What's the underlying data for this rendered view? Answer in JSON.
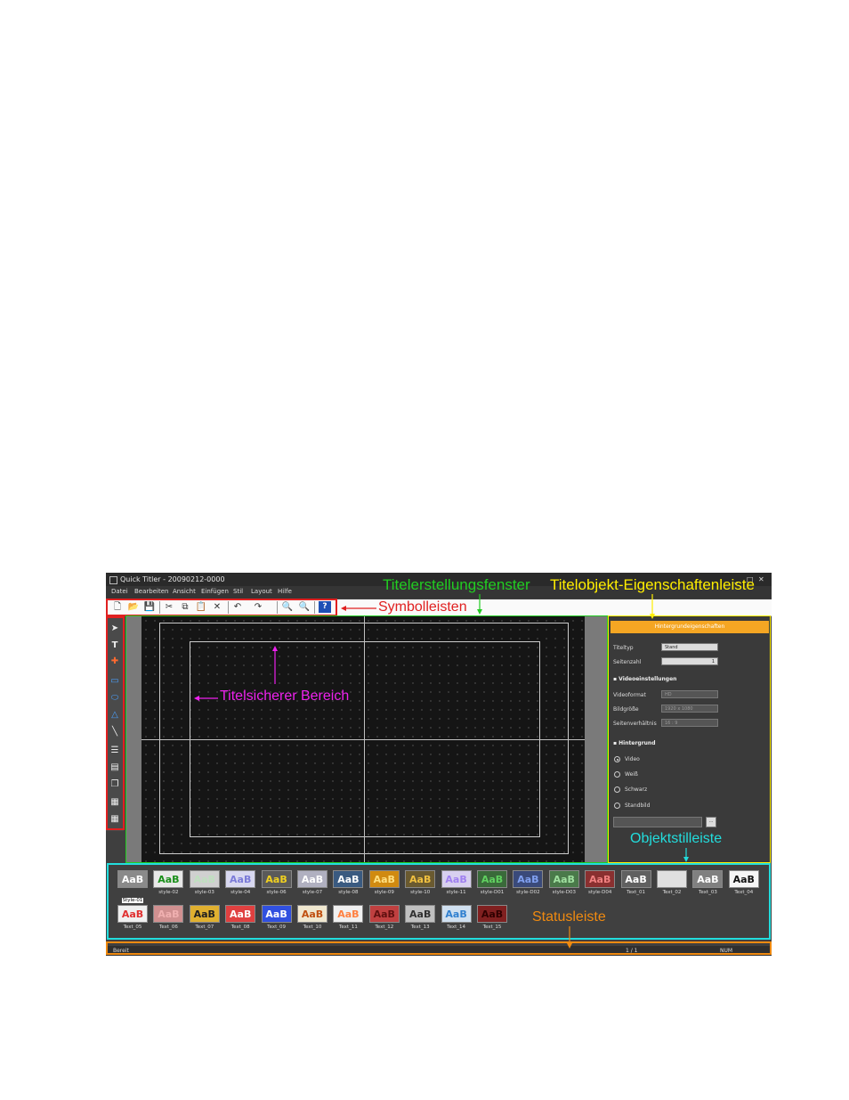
{
  "window": {
    "title": "Quick Titler - 20090212-0000",
    "controls": [
      "_",
      "□",
      "✕"
    ]
  },
  "menu": [
    "Datei",
    "Bearbeiten",
    "Ansicht",
    "Einfügen",
    "Stil",
    "Layout",
    "Hilfe"
  ],
  "toolbar": {
    "new": "🗋",
    "open": "📂",
    "save": "💾",
    "cut": "✂",
    "copy": "⧉",
    "paste": "📋",
    "delete": "✕",
    "undo": "↶",
    "redo": "↷",
    "zoom_in": "🔍",
    "zoom_out": "🔍",
    "help": "?"
  },
  "left_tools": [
    "select-arrow-icon",
    "text-icon",
    "cross-icon",
    "rectangle-icon",
    "ellipse-icon",
    "triangle-icon",
    "line-icon",
    "align-left-icon",
    "align-center-icon",
    "layer-icon",
    "grid-icon",
    "table-icon"
  ],
  "properties": {
    "header": "Hintergrundeigenschaften",
    "titeltyp_label": "Titeltyp",
    "titeltyp_value": "Stand",
    "seitenzahl_label": "Seitenzahl",
    "seitenzahl_value": "1",
    "video_section": "Videoeinstellungen",
    "videoformat_label": "Videoformat",
    "videoformat_value": "HD",
    "bildgroesse_label": "Bildgröße",
    "bildgroesse_value": "1920 x 1080",
    "seitenverhaeltnis_label": "Seitenverhältnis",
    "seitenverhaeltnis_value": "16 : 9",
    "background_section": "Hintergrund",
    "radio_video": "Video",
    "radio_weiss": "Weiß",
    "radio_schwarz": "Schwarz",
    "radio_standbild": "Standbild",
    "browse": "..."
  },
  "styles": [
    {
      "name": "Style-01",
      "text": "AaB",
      "fg": "#ffffff",
      "bg": "#8a8a8a"
    },
    {
      "name": "style-02",
      "text": "AaB",
      "fg": "#1a8f1a",
      "bg": "#e8e8e8"
    },
    {
      "name": "style-03",
      "text": "AaB",
      "fg": "#bfe0bf",
      "bg": "#d0d0d0"
    },
    {
      "name": "style-04",
      "text": "AaB",
      "fg": "#7b7bd8",
      "bg": "#d8d8f0"
    },
    {
      "name": "style-06",
      "text": "AaB",
      "fg": "#f0d020",
      "bg": "#5a5a5a"
    },
    {
      "name": "style-07",
      "text": "AaB",
      "fg": "#ffffff",
      "bg": "#b0b0c0"
    },
    {
      "name": "style-08",
      "text": "AaB",
      "fg": "#ffffff",
      "bg": "#3a5a80"
    },
    {
      "name": "style-09",
      "text": "AaB",
      "fg": "#ffe080",
      "bg": "#d08a10"
    },
    {
      "name": "style-10",
      "text": "AaB",
      "fg": "#f0c040",
      "bg": "#6a5a30"
    },
    {
      "name": "style-11",
      "text": "AaB",
      "fg": "#a080f0",
      "bg": "#d8d0f0"
    },
    {
      "name": "style-D01",
      "text": "AaB",
      "fg": "#60d060",
      "bg": "#3a6a3a"
    },
    {
      "name": "style-D02",
      "text": "AaB",
      "fg": "#80a0f0",
      "bg": "#3a4a7a"
    },
    {
      "name": "style-D03",
      "text": "AaB",
      "fg": "#a0e0a0",
      "bg": "#4a7a4a"
    },
    {
      "name": "style-D04",
      "text": "AaB",
      "fg": "#f08080",
      "bg": "#8a3030"
    },
    {
      "name": "Text_01",
      "text": "AaB",
      "fg": "#ffffff",
      "bg": "#606060"
    },
    {
      "name": "Text_02",
      "text": "AaB",
      "fg": "#e0e0e0",
      "bg": "#e0e0e0"
    },
    {
      "name": "Text_03",
      "text": "AaB",
      "fg": "#ffffff",
      "bg": "#808080"
    },
    {
      "name": "Text_04",
      "text": "AaB",
      "fg": "#111111",
      "bg": "#f5f5f5"
    },
    {
      "name": "Text_05",
      "text": "AaB",
      "fg": "#e03030",
      "bg": "#f0f0f0"
    },
    {
      "name": "Text_06",
      "text": "AaB",
      "fg": "#f0b0b0",
      "bg": "#d09090"
    },
    {
      "name": "Text_07",
      "text": "AaB",
      "fg": "#202020",
      "bg": "#e0b030"
    },
    {
      "name": "Text_08",
      "text": "AaB",
      "fg": "#ffffff",
      "bg": "#e04040"
    },
    {
      "name": "Text_09",
      "text": "AaB",
      "fg": "#ffffff",
      "bg": "#3050e0"
    },
    {
      "name": "Text_10",
      "text": "AaB",
      "fg": "#c05010",
      "bg": "#f0e8d0"
    },
    {
      "name": "Text_11",
      "text": "AaB",
      "fg": "#ff8040",
      "bg": "#f0f0f0"
    },
    {
      "name": "Text_12",
      "text": "AaB",
      "fg": "#601010",
      "bg": "#c04040"
    },
    {
      "name": "Text_13",
      "text": "AaB",
      "fg": "#303030",
      "bg": "#c0c0c0"
    },
    {
      "name": "Text_14",
      "text": "AaB",
      "fg": "#3080d0",
      "bg": "#d0e0f0"
    },
    {
      "name": "Text_15",
      "text": "AaB",
      "fg": "#300000",
      "bg": "#802020"
    }
  ],
  "status": {
    "left": "Bereit",
    "page": "1 / 1",
    "num": "NUM"
  },
  "annotations": {
    "titelerstellungsfenster": "Titelerstellungsfenster",
    "eigenschaftenleiste": "Titelobjekt-Eigenschaftenleiste",
    "symbolleisten": "Symbolleisten",
    "titelsicherer": "Titelsicherer Bereich",
    "objektstilleiste": "Objektstilleiste",
    "statusleiste": "Statusleiste"
  },
  "colors": {
    "green": "#22cc22",
    "yellow": "#ffee00",
    "red": "#e02020",
    "magenta": "#ee22ee",
    "cyan": "#22dddd",
    "orange": "#f08a10"
  }
}
